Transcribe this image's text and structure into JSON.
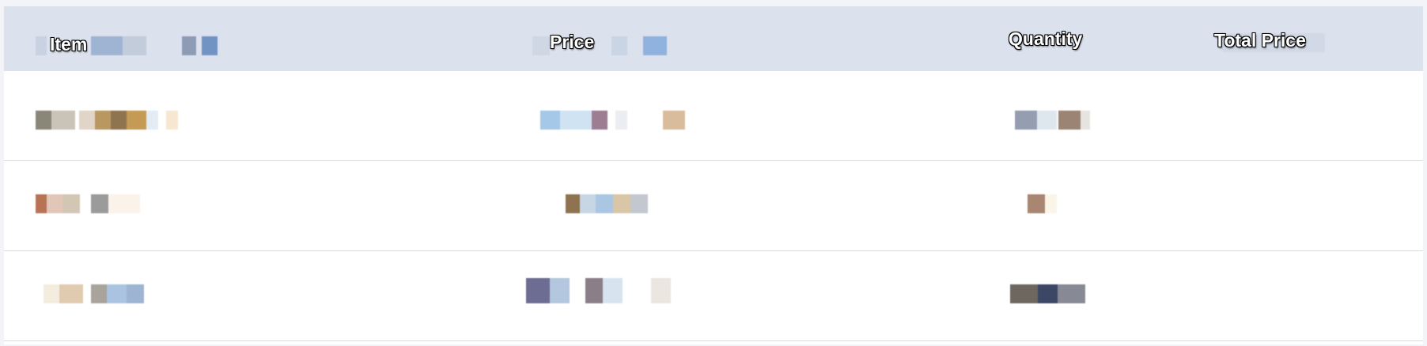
{
  "table": {
    "columns": [
      {
        "label": "Item"
      },
      {
        "label": "Price"
      },
      {
        "label": "Quantity"
      },
      {
        "label": "Total Price"
      }
    ],
    "rows": [
      {
        "item": "",
        "price": "",
        "quantity": "",
        "total": ""
      },
      {
        "item": "",
        "price": "",
        "quantity": "",
        "total": ""
      },
      {
        "item": "",
        "price": "",
        "quantity": "",
        "total": ""
      }
    ]
  },
  "colors": {
    "header_bg": "#dbe2ee",
    "row_border": "#d6d9de",
    "page_bg": "#f3f4f8"
  }
}
